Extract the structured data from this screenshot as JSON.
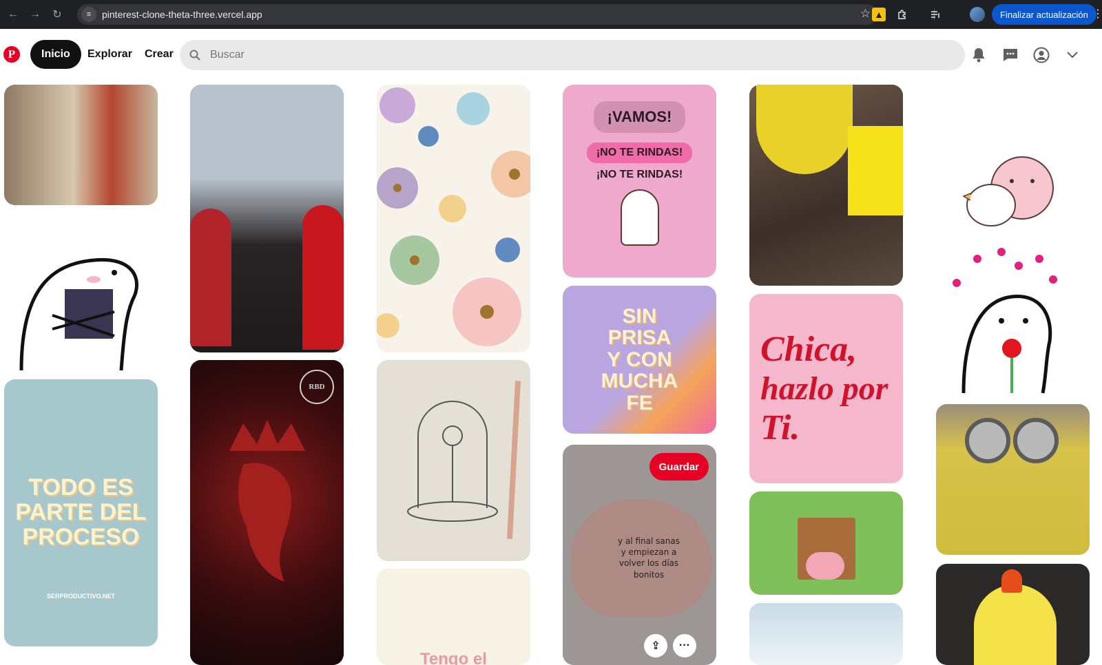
{
  "browser": {
    "url": "pinterest-clone-theta-three.vercel.app",
    "update_button": "Finalizar actualización",
    "icons": [
      "back-icon",
      "forward-icon",
      "reload-icon",
      "site-settings-icon",
      "bookmark-star-icon",
      "extension-icon",
      "puzzle-icon",
      "media-icon",
      "profile-avatar",
      "menu-kebab-icon"
    ]
  },
  "header": {
    "logo": "P",
    "nav": {
      "home": "Inicio",
      "explore": "Explorar",
      "create": "Crear"
    },
    "search": {
      "placeholder": "Buscar"
    },
    "icons": [
      "notifications-bell-icon",
      "messages-icon",
      "account-icon",
      "chevron-down-icon"
    ]
  },
  "pins": {
    "todo": {
      "line1": "TODO ES",
      "line2": "PARTE DEL",
      "line3": "PROCESO",
      "footer": "SERPRODUCTIVO.NET"
    },
    "vamos": {
      "line1": "¡VAMOS!",
      "line2": "¡NO TE RINDAS!",
      "line3": "¡NO TE RINDAS!"
    },
    "sinprisa": {
      "line1": "SIN",
      "line2": "PRISA",
      "line3": "Y CON",
      "line4": "MUCHA",
      "line5": "FE"
    },
    "palette": {
      "line1": "y al final sanas",
      "line2": "y empiezan a",
      "line3": "volver los días",
      "line4": "bonitos"
    },
    "chica": {
      "line1": "Chica,",
      "line2": "hazlo por",
      "line3": "Ti."
    },
    "rbd_crest": "RBD",
    "tengo": "Tengo el",
    "save_label": "Guardar",
    "share_icon": "⇪",
    "more_icon": "···"
  },
  "colors": {
    "brand_red": "#e60023",
    "search_bg": "#e9e9e9",
    "chrome_bg": "#202124",
    "update_blue": "#0b57d0"
  }
}
